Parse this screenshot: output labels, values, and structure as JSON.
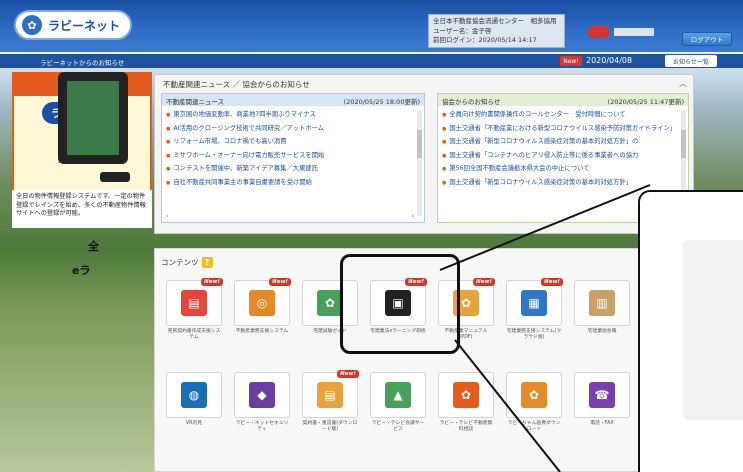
{
  "header": {
    "logo_text": "ラビーネット",
    "user_line1": "全日本不動産協会流通センター　相多協用",
    "user_line2": "ユーザー名：金子啓",
    "user_line3": "前回ログイン：2020/05/14 14:17",
    "logout_label": "ログアウト"
  },
  "infobar": {
    "title": "ラビーネットからのお知らせ",
    "new_badge": "New!",
    "date": "2020/04/08",
    "list_button": "お知らせ一覧"
  },
  "promo": {
    "top_line1": "登録・検索",
    "top_line2": "システム",
    "logo": "ラビーネット",
    "bang": "！！",
    "main_line1": "物件情報の",
    "main_line2": "登録はココ！",
    "desc": "全日の物件情報登録システムです。一定の物件登録でレインズを始め、多くの不動産物件情報サイトへの登録が可能。"
  },
  "news": {
    "title": "不動産関連ニュース ／ 協会からのお知らせ",
    "left": {
      "header": "不動産関連ニュース",
      "updated": "(2020/05/25 18:00更新)",
      "items": [
        "東京圏の地価変動率、商業地7四半期ぶりマイナス",
        "AI活用のクロージング技術で共同研究／アットホーム",
        "リフォーム市場、コロナ禍でも高い消費",
        "ミサワホーム・オーナー向け電力販売サービスを開始",
        "コンテストを開催中、新築アイデア募集／大東建託",
        "自社不動産共同事業主の事業自粛要請を受け開始"
      ]
    },
    "right": {
      "header": "協会からのお知らせ",
      "updated": "(2020/05/25 11:47更新)",
      "items": [
        "全員向け契約書関係操作のコールセンター　受付時間について",
        "国土交通省「不動産業における新型コロナウイルス感染予防対策ガイドライン」",
        "国土交通省「新型コロナウイルス感染症対策の基本的対処方針」の",
        "国土交通省「コンテナへのヒアリ侵入防止等に係る事業者への協力",
        "第56回全国不動産会議栃木県大会の中止について",
        "国土交通省「新型コロナウイルス感染症対策の基本的対処方針」"
      ]
    }
  },
  "contents": {
    "title": "コンテンツ",
    "help": "?",
    "tiles": [
      {
        "label": "売買契約書作成支援システム",
        "new": "New!",
        "color": "#e5463b",
        "glyph": "▤"
      },
      {
        "label": "不動産業務支援システム",
        "new": "New!",
        "color": "#e58a2b",
        "glyph": "◎"
      },
      {
        "label": "宅建試験ガイド",
        "new": "",
        "color": "#4aa05a",
        "glyph": "✿"
      },
      {
        "label": "宅建業法eラーニング研修",
        "new": "New!",
        "color": "#222222",
        "glyph": "▣"
      },
      {
        "label": "不動産業マニュアル(PDF)",
        "new": "New!",
        "color": "#e8a43c",
        "glyph": "✿"
      },
      {
        "label": "宅建業務支援システム(クラウド版)",
        "new": "New!",
        "color": "#2f76c9",
        "glyph": "▦"
      },
      {
        "label": "宅建業協会報",
        "new": "",
        "color": "#c9a06a",
        "glyph": "▥"
      },
      {
        "label": "VR内見",
        "new": "",
        "color": "#1d6fb5",
        "glyph": "◍"
      },
      {
        "label": "ラビー・ネットセキュリティ",
        "new": "",
        "color": "#6a3fa0",
        "glyph": "◆"
      },
      {
        "label": "契約書・重説書(ダウンロード版)",
        "new": "New!",
        "color": "#e8a43c",
        "glyph": "▤"
      },
      {
        "label": "ラビー・テレビ会議サービス",
        "new": "",
        "color": "#4aa05a",
        "glyph": "▲"
      },
      {
        "label": "ラビー・テレビ不動産無料相談",
        "new": "",
        "color": "#e55b1d",
        "glyph": "✿"
      },
      {
        "label": "ラビーちゃん画像ダウンロード",
        "new": "",
        "color": "#e58a2b",
        "glyph": "✿"
      },
      {
        "label": "電話・FAX",
        "new": "",
        "color": "#7a3fb0",
        "glyph": "☎"
      }
    ]
  },
  "zoom": {
    "label1": "全",
    "label2": "eラ"
  }
}
